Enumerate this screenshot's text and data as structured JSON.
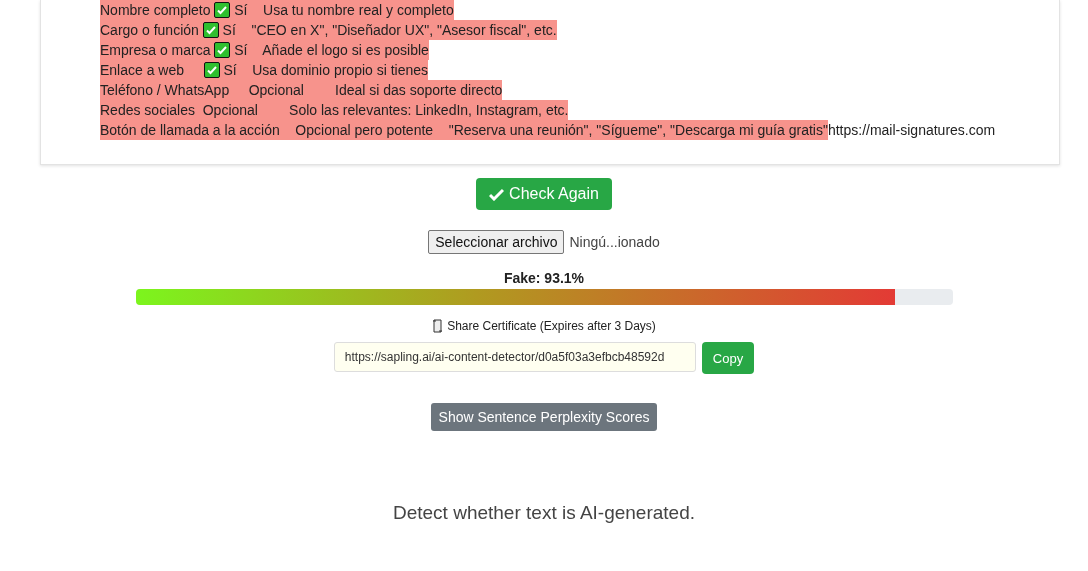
{
  "result_lines": [
    {
      "segments": [
        {
          "kind": "text",
          "text": "Nombre completo ",
          "highlighted": true
        },
        {
          "kind": "check",
          "highlighted": true
        },
        {
          "kind": "text",
          "text": " Sí    Usa tu nombre real y completo",
          "highlighted": true
        }
      ]
    },
    {
      "segments": [
        {
          "kind": "text",
          "text": "Cargo o función ",
          "highlighted": true
        },
        {
          "kind": "check",
          "highlighted": true
        },
        {
          "kind": "text",
          "text": " Sí    \"CEO en X\", \"Diseñador UX\", \"Asesor fiscal\", etc.",
          "highlighted": true
        }
      ]
    },
    {
      "segments": [
        {
          "kind": "text",
          "text": "Empresa o marca ",
          "highlighted": true
        },
        {
          "kind": "check",
          "highlighted": true
        },
        {
          "kind": "text",
          "text": " Sí    Añade el logo si es posible",
          "highlighted": true
        }
      ]
    },
    {
      "segments": [
        {
          "kind": "text",
          "text": "Enlace a web     ",
          "highlighted": true
        },
        {
          "kind": "check",
          "highlighted": true
        },
        {
          "kind": "text",
          "text": " Sí    Usa dominio propio si tienes",
          "highlighted": true
        }
      ]
    },
    {
      "segments": [
        {
          "kind": "text",
          "text": "Teléfono / WhatsApp     Opcional        Ideal si das soporte directo",
          "highlighted": true
        }
      ]
    },
    {
      "segments": [
        {
          "kind": "text",
          "text": "Redes sociales  Opcional        Solo las relevantes: LinkedIn, Instagram, etc.",
          "highlighted": true
        }
      ]
    },
    {
      "segments": [
        {
          "kind": "text",
          "text": "Botón de llamada a la acción    Opcional pero potente    \"Reserva una reunión\", \"Sígueme\", \"Descarga mi guía gratis\"",
          "highlighted": true
        },
        {
          "kind": "text",
          "text": "https://mail-signatures.com",
          "highlighted": false
        }
      ]
    }
  ],
  "check_button": {
    "label": "Check Again"
  },
  "file_input": {
    "button": "Seleccionar archivo",
    "status": "Ningú...ionado"
  },
  "score": {
    "label": "Fake: 93.1%",
    "level": 0.93
  },
  "share": {
    "label": "Share Certificate (Expires after 3 Days)",
    "url": "https://sapling.ai/ai-content-detector/d0a5f03a3efbcb48592d",
    "copy": "Copy"
  },
  "perplexity_button": {
    "label": "Show Sentence Perplexity Scores"
  },
  "tagline": "Detect whether text is AI-generated."
}
